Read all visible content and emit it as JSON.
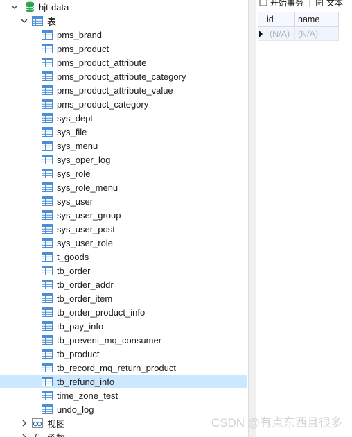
{
  "tree": {
    "database_name": "hjt-data",
    "tables_folder": "表",
    "tables": [
      "pms_brand",
      "pms_product",
      "pms_product_attribute",
      "pms_product_attribute_category",
      "pms_product_attribute_value",
      "pms_product_category",
      "sys_dept",
      "sys_file",
      "sys_menu",
      "sys_oper_log",
      "sys_role",
      "sys_role_menu",
      "sys_user",
      "sys_user_group",
      "sys_user_post",
      "sys_user_role",
      "t_goods",
      "tb_order",
      "tb_order_addr",
      "tb_order_item",
      "tb_order_product_info",
      "tb_pay_info",
      "tb_prevent_mq_consumer",
      "tb_product",
      "tb_record_mq_return_product",
      "tb_refund_info",
      "time_zone_test",
      "undo_log"
    ],
    "selected_table": "tb_refund_info",
    "views_folder": "视图",
    "functions_folder": "函数"
  },
  "right_pane": {
    "toolbar": {
      "begin_transaction": "开始事务",
      "text": "文本"
    },
    "grid": {
      "columns": [
        "id",
        "name"
      ],
      "rows": [
        [
          "(N/A)",
          "(N/A)"
        ]
      ]
    }
  },
  "watermark": "CSDN @有点东西且很多",
  "colors": {
    "selected_row": "#cce8ff",
    "table_icon": "#4a8fd6",
    "db_icon": "#2ea44f"
  }
}
